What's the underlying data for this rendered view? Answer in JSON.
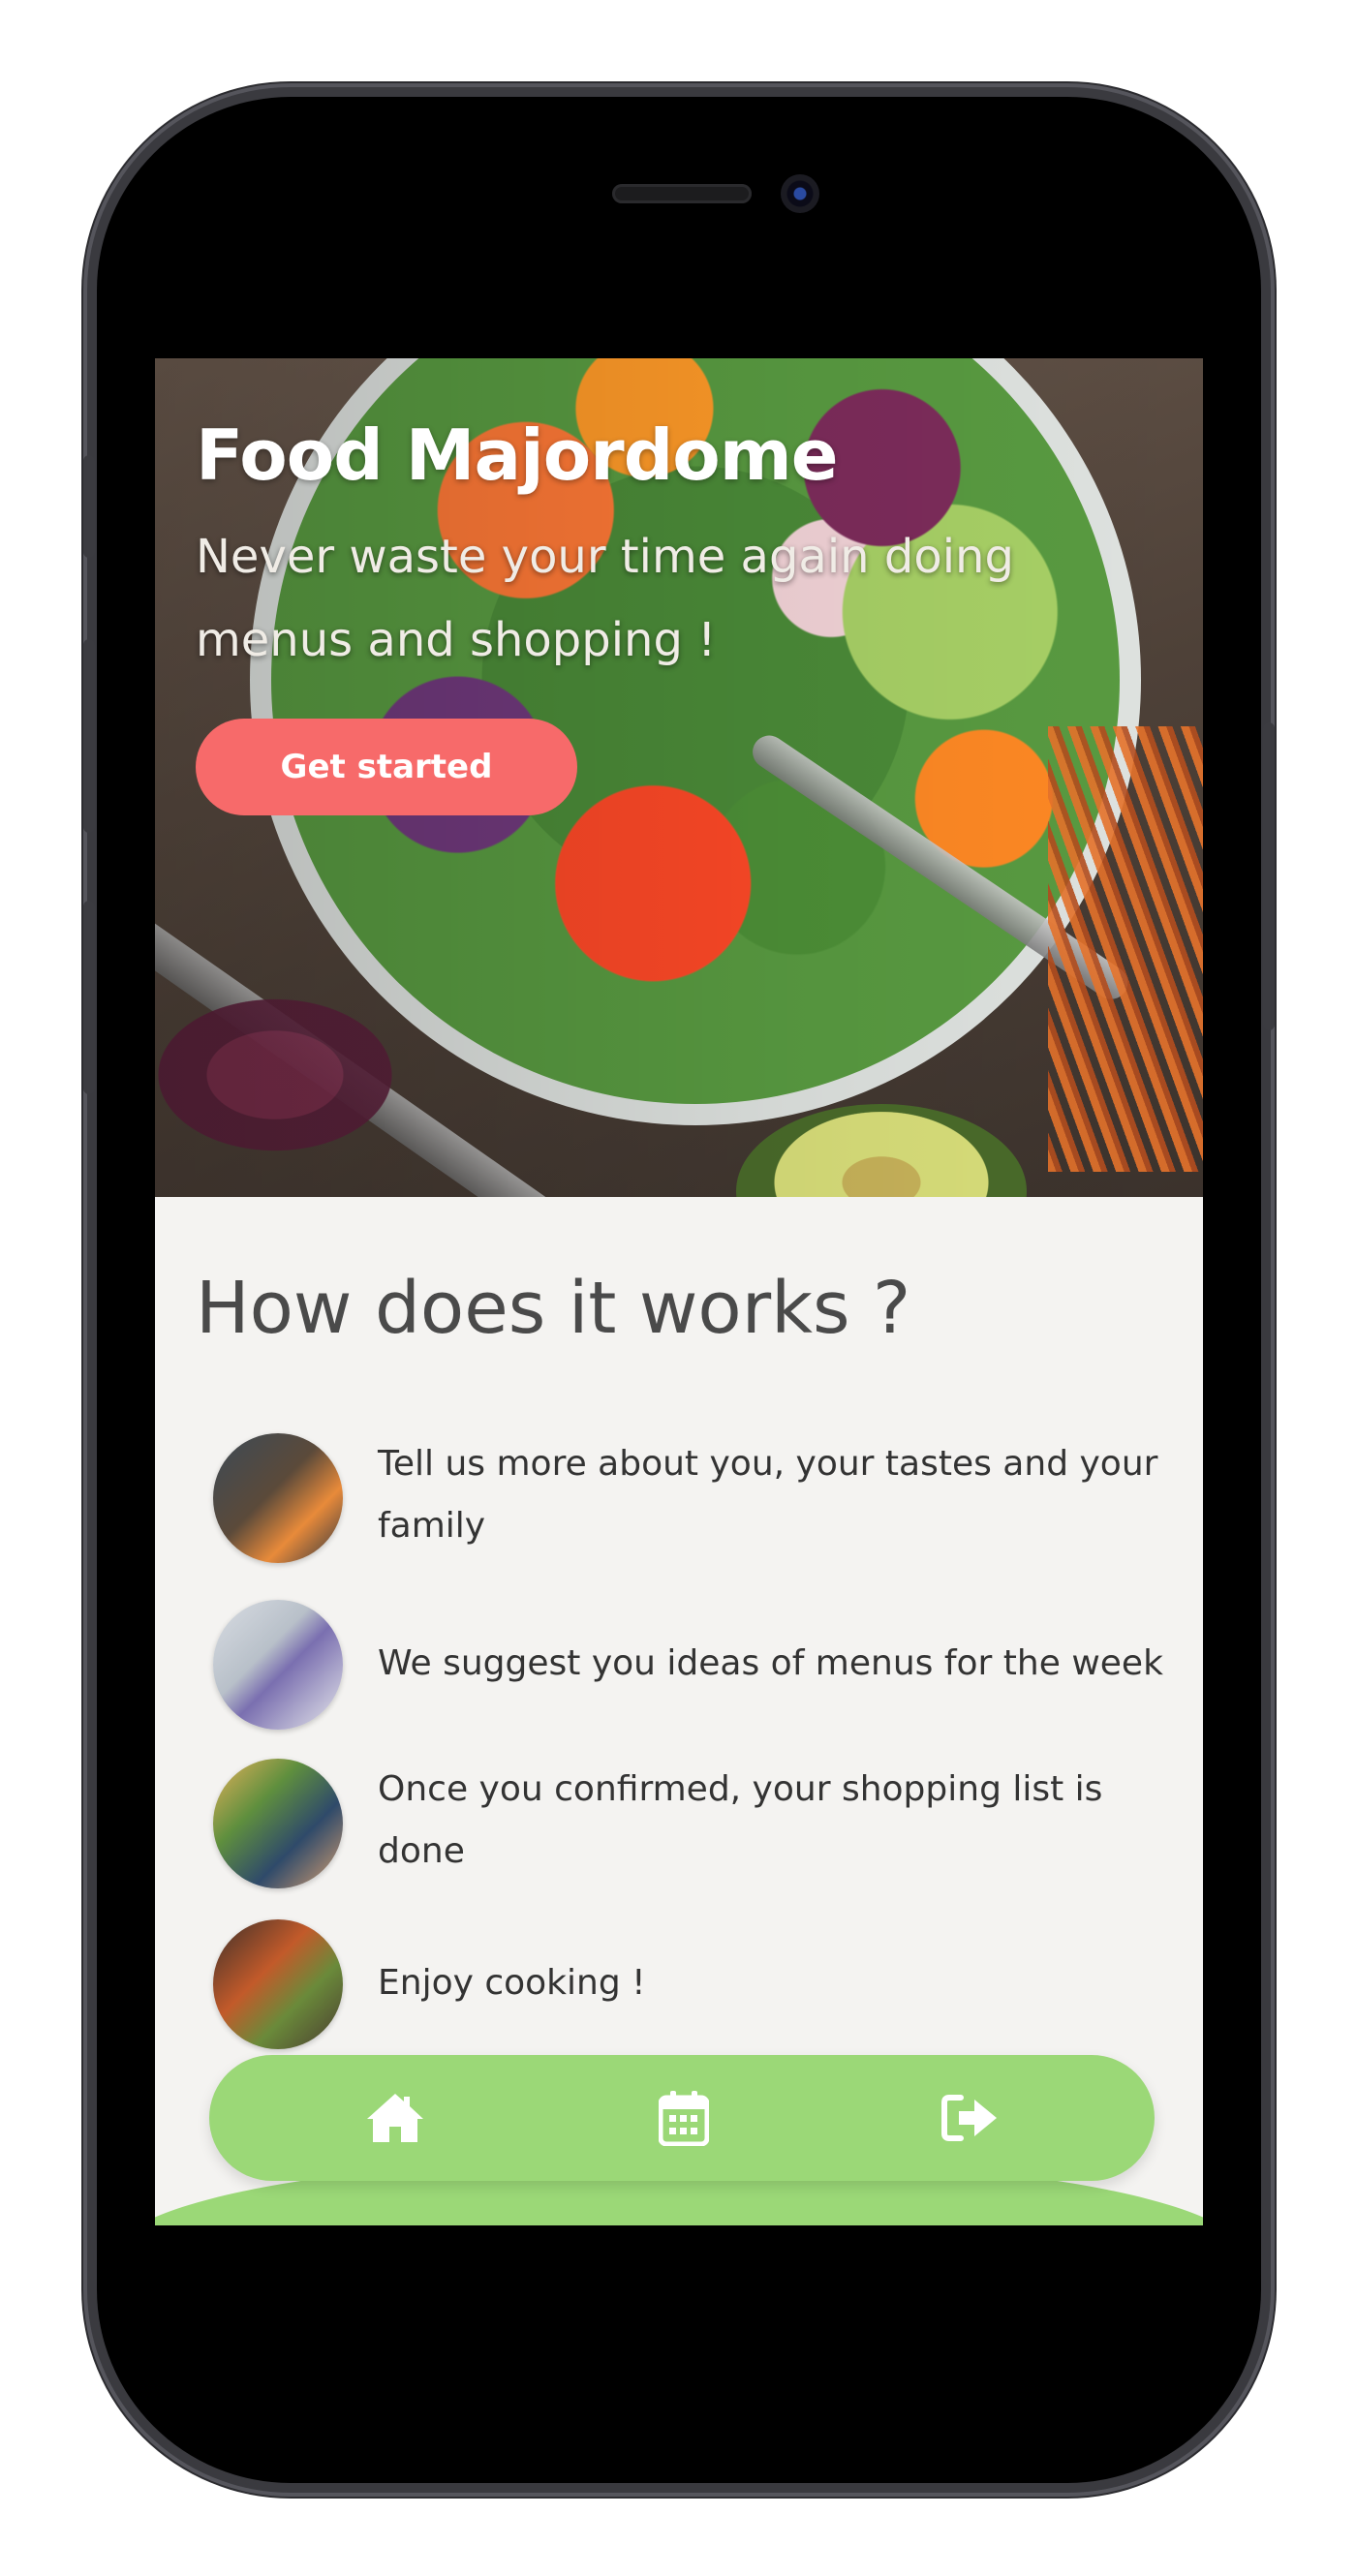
{
  "hero": {
    "title": "Food Majordome",
    "subtitle": "Never waste your time again doing menus and shopping !",
    "cta_label": "Get started"
  },
  "how": {
    "title": "How does it works ?",
    "steps": [
      {
        "text": "Tell us more about you, your tastes and your family",
        "image": "kitchen-photo"
      },
      {
        "text": "We suggest you ideas of menus for the week",
        "image": "phone-photo"
      },
      {
        "text": "Once you confirmed, your shopping list is done",
        "image": "groceries-photo"
      },
      {
        "text": "Enjoy cooking !",
        "image": "vegetables-photo"
      }
    ]
  },
  "nav": {
    "items": [
      {
        "icon": "home-icon"
      },
      {
        "icon": "calendar-icon"
      },
      {
        "icon": "logout-icon"
      }
    ]
  },
  "colors": {
    "accent": "#f76a6a",
    "nav": "#9bd877",
    "background": "#f4f3f1",
    "heading": "#4a4a4a"
  }
}
